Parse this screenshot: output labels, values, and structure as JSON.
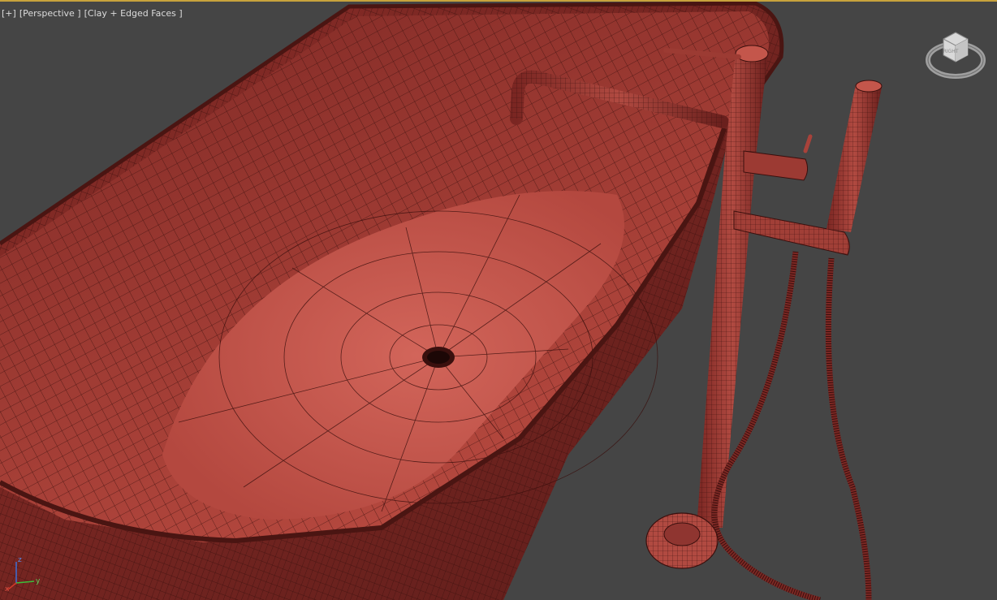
{
  "viewport": {
    "label_plus": "[+]",
    "label_view": "[Perspective ]",
    "label_shading": "[Clay + Edged Faces ]",
    "viewcube_face": "RIGHT",
    "axes": {
      "z": "z",
      "y": "y",
      "x": "x"
    },
    "colors": {
      "background": "#454545",
      "active_border": "#c8a23c",
      "clay_light": "#c9594d",
      "clay_mid": "#a8423a",
      "clay_dark": "#6e2320",
      "wire": "#3a0f0d",
      "axis_x": "#d23a2a",
      "axis_y": "#3bbf3b",
      "axis_z": "#3b6fd6"
    }
  }
}
